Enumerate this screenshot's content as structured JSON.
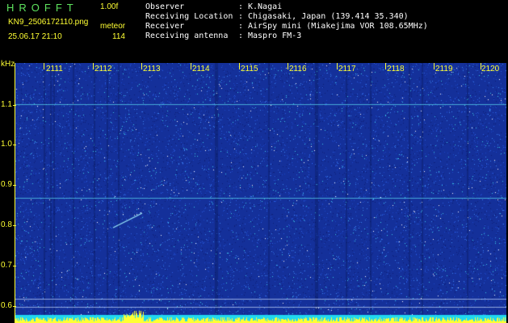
{
  "header": {
    "logo": "HROFFT",
    "version": "1.00f",
    "filename": "KN9_2506172110.png",
    "mode": "meteor",
    "datetime": "25.06.17 21:10",
    "count": "114"
  },
  "info": [
    {
      "label": "Observer",
      "value": "K.Nagai"
    },
    {
      "label": "Receiving Location",
      "value": "Chigasaki, Japan (139.414 35.340)"
    },
    {
      "label": "Receiver",
      "value": "AirSpy mini (Miakejima VOR 108.65MHz)"
    },
    {
      "label": "Receiving antenna",
      "value": "Maspro FM-3"
    }
  ],
  "colon": ":",
  "plot": {
    "unit": "kHz",
    "y_labels": [
      "1.1",
      "1.0",
      "0.9",
      "0.8",
      "0.7",
      "0.6"
    ],
    "x_labels": [
      "2111",
      "2112",
      "2113",
      "2114",
      "2115",
      "2116",
      "2117",
      "2118",
      "2119",
      "2120"
    ],
    "colors": {
      "background": "#14309a",
      "noise_bright": "#3cc8e6",
      "axis": "#ffff33",
      "bottom_band": "#20d8f0"
    }
  }
}
